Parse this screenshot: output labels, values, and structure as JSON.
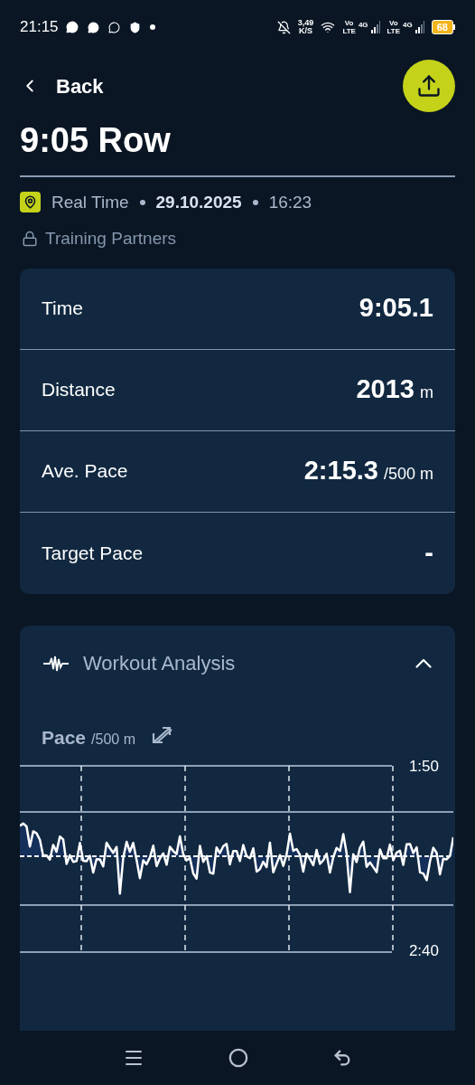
{
  "status_bar": {
    "time": "21:15",
    "speed": "3,49",
    "speed_unit": "K/S",
    "sims": [
      {
        "volte_top": "Vo",
        "volte_bottom": "LTE",
        "network": "4G"
      },
      {
        "volte_top": "Vo",
        "volte_bottom": "LTE",
        "network": "4G"
      }
    ],
    "battery": "68"
  },
  "header": {
    "back_label": "Back",
    "title": "9:05 Row"
  },
  "meta": {
    "mode": "Real Time",
    "date": "29.10.2025",
    "time": "16:23",
    "visibility": "Training Partners"
  },
  "stats": [
    {
      "label": "Time",
      "value": "9:05.1"
    },
    {
      "label": "Distance",
      "value": "2013",
      "unit": "m"
    },
    {
      "label": "Ave. Pace",
      "value": "2:15.3",
      "unit": "/500 m"
    },
    {
      "label": "Target Pace",
      "value": "-"
    }
  ],
  "analysis": {
    "title": "Workout Analysis",
    "expanded": true,
    "metric": "Pace",
    "metric_unit": "/500 m",
    "y_top_label": "1:50",
    "y_bottom_label": "2:40"
  }
}
